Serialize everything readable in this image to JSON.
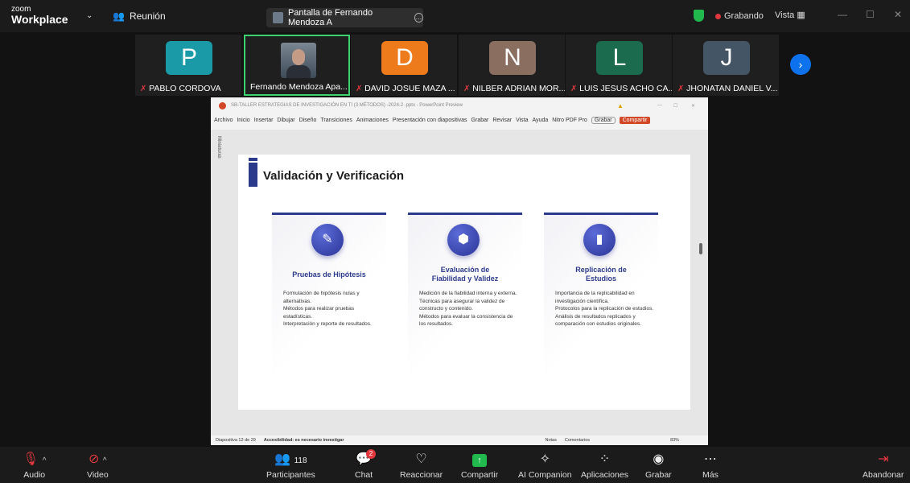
{
  "header": {
    "logo_line1": "zoom",
    "logo_line2": "Workplace",
    "meeting_label": "Reunión",
    "share_label": "Pantalla de Fernando Mendoza A",
    "recording_label": "Grabando",
    "view_label": "Vista"
  },
  "participants": [
    {
      "initial": "P",
      "name": "PABLO CORDOVA",
      "color": "#1a9aa7"
    },
    {
      "initial": "",
      "name": "Fernando Mendoza Apa...",
      "color": "#6c7a8a"
    },
    {
      "initial": "D",
      "name": "DAVID JOSUE MAZA ...",
      "color": "#ee7b1b"
    },
    {
      "initial": "N",
      "name": "NILBER ADRIAN MOR...",
      "color": "#8a6e60"
    },
    {
      "initial": "L",
      "name": "LUIS JESUS ACHO CA...",
      "color": "#1b6b4f"
    },
    {
      "initial": "J",
      "name": "JHONATAN DANIEL V...",
      "color": "#445566"
    }
  ],
  "ppt": {
    "window_title": "SB-TALLER ESTRATEGIAS DE INVESTIGACIÓN EN TI (3 MÉTODOS) -2024-2 .pptx - PowerPoint Preview",
    "menu": [
      "Archivo",
      "Inicio",
      "Insertar",
      "Dibujar",
      "Diseño",
      "Transiciones",
      "Animaciones",
      "Presentación con diapositivas",
      "Grabar",
      "Revisar",
      "Vista",
      "Ayuda",
      "Nitro PDF Pro"
    ],
    "grabar_btn": "Grabar",
    "compartir_btn": "Compartir",
    "miniaturas": "Miniaturas",
    "slide_title": "Validación y Verificación",
    "cards": [
      {
        "title": "Pruebas de Hipótesis",
        "icon": "✎",
        "body": "Formulación de hipótesis nulas y alternativas.\nMétodos para realizar pruebas estadísticas.\nInterpretación y reporte de resultados."
      },
      {
        "title": "Evaluación de Fiabilidad y Validez",
        "icon": "⬢",
        "body": "Medición de la fiabilidad interna y externa.\nTécnicas para asegurar la validez de constructo y contenido.\nMétodos para evaluar la consistencia de los resultados."
      },
      {
        "title": "Replicación de Estudios",
        "icon": "▮",
        "body": "Importancia de la replicabilidad en investigación científica.\nProtocolos para la replicación de estudios.\nAnálisis de resultados replicados y comparación con estudios originales."
      }
    ],
    "status_slide": "Diapositiva 12 de 29",
    "status_access": "Accesibilidad: es necesario investigar",
    "status_notes": "Notas",
    "status_comments": "Comentarios",
    "zoom": "83%"
  },
  "toolbar": {
    "audio": "Audio",
    "video": "Video",
    "participants": "Participantes",
    "participants_count": "118",
    "chat": "Chat",
    "chat_badge": "2",
    "react": "Reaccionar",
    "share": "Compartir",
    "ai": "AI Companion",
    "apps": "Aplicaciones",
    "record": "Grabar",
    "more": "Más",
    "leave": "Abandonar"
  }
}
